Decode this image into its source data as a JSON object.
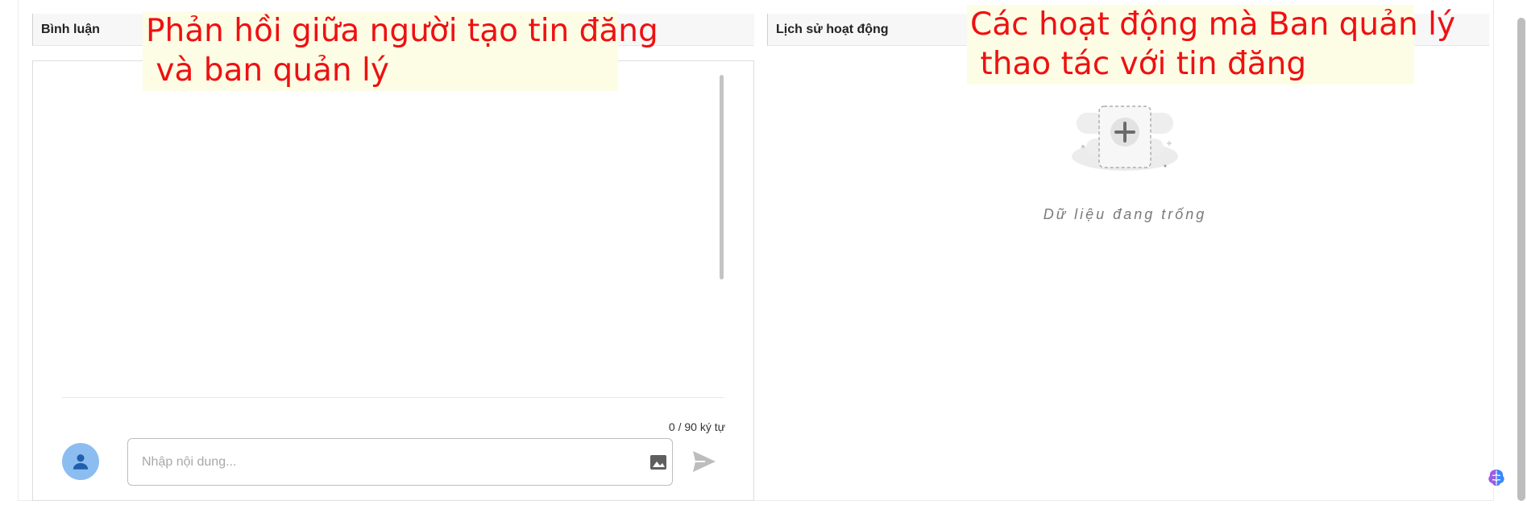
{
  "comments": {
    "header": "Bình luận",
    "char_count": "0 / 90 ký tự",
    "input_placeholder": "Nhập nội dung...",
    "input_value": ""
  },
  "history": {
    "header": "Lịch sử hoạt động",
    "empty_text": "Dữ liệu đang trống"
  },
  "annotations": {
    "left": "Phản hồi giữa người tạo tin đăng\n và ban quản lý",
    "right": "Các hoạt động mà Ban quản lý\n thao tác với tin đăng"
  },
  "colors": {
    "annotation_text": "#ee1111",
    "annotation_bg": "#fdfde6",
    "avatar_bg": "#8cbdf0"
  },
  "icons": [
    "user-icon",
    "image-icon",
    "send-icon",
    "empty-box-icon",
    "plus-icon",
    "ai-brain-icon"
  ]
}
